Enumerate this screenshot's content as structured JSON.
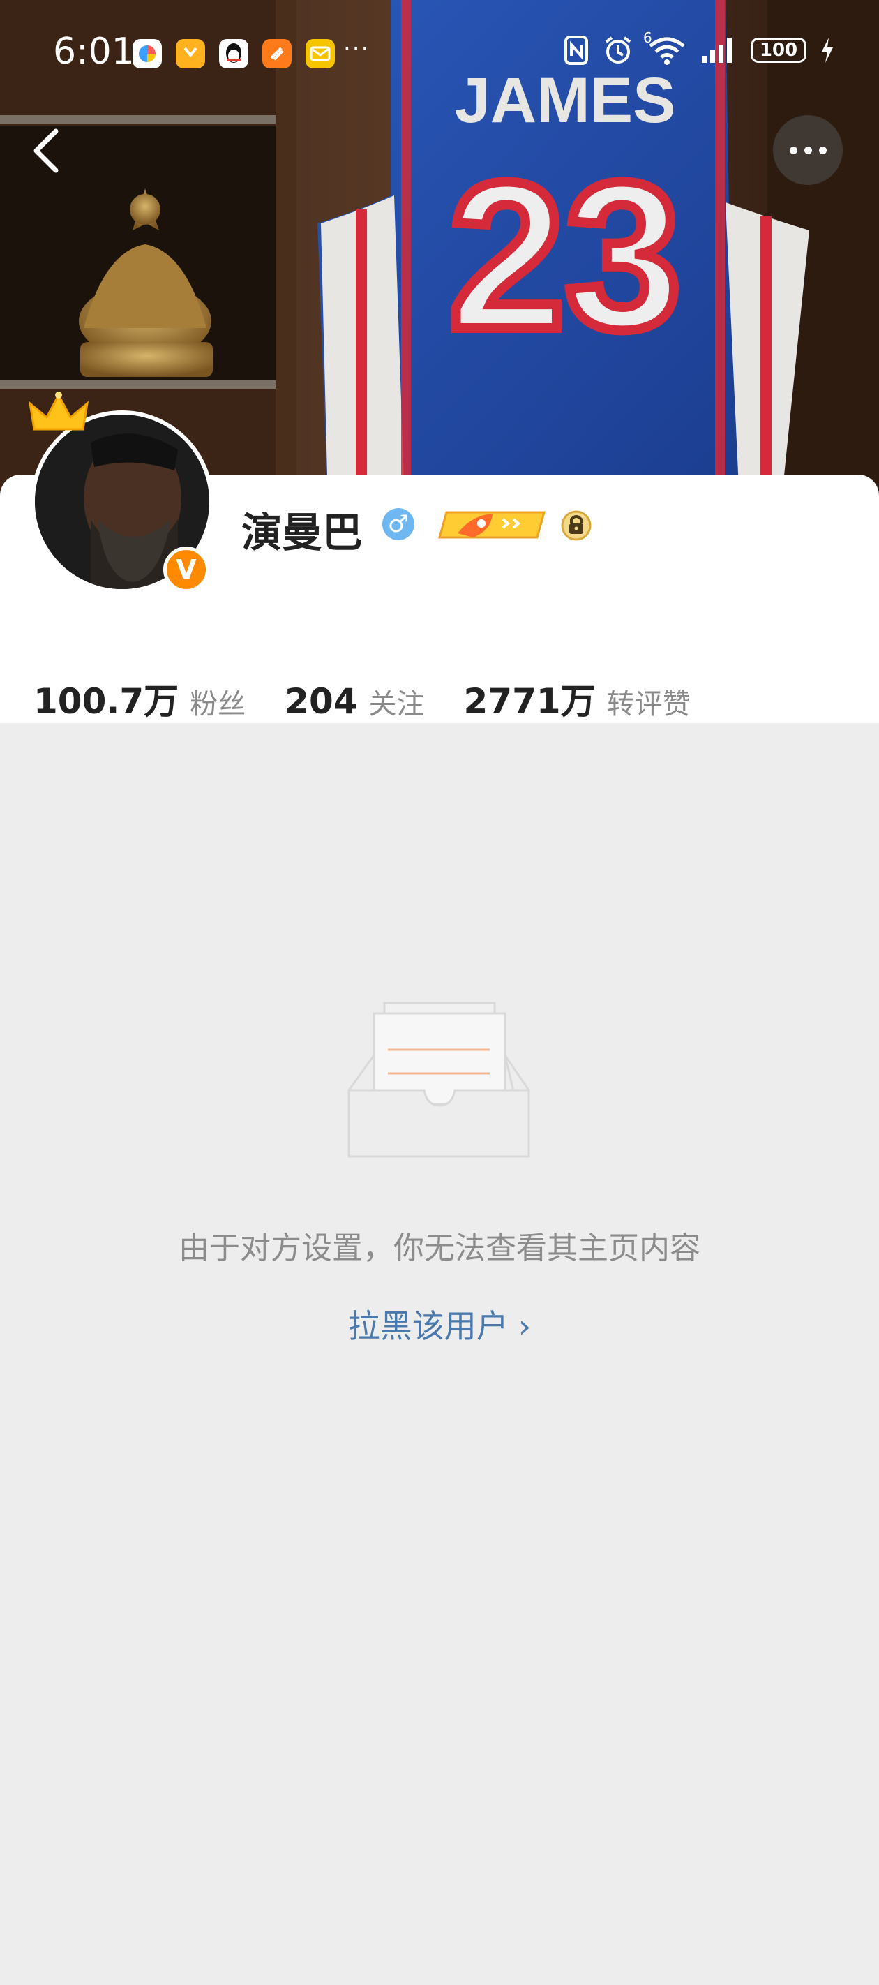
{
  "status_bar": {
    "time": "6:01",
    "more": "···",
    "network": "6",
    "battery": "100"
  },
  "profile": {
    "name": "演曼巴",
    "gender_symbol": "♂",
    "verified_badge": "V"
  },
  "stats": [
    {
      "value": "100.7万",
      "label": "粉丝"
    },
    {
      "value": "204",
      "label": "关注"
    },
    {
      "value": "2771万",
      "label": "转评赞"
    }
  ],
  "cover": {
    "jersey_name": "JAMES",
    "jersey_number": "23"
  },
  "empty_state": {
    "message": "由于对方设置，你无法查看其主页内容",
    "action": "拉黑该用户",
    "action_chevron": "›"
  },
  "colors": {
    "background": "#ededed",
    "link": "#4a79ad",
    "verified": "#ff8a00",
    "gender": "#6fb7f0"
  }
}
